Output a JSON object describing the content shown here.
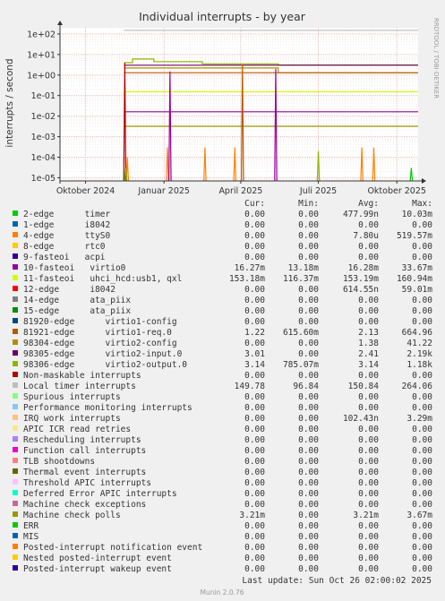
{
  "chart_data": {
    "type": "line",
    "title": "Individual interrupts - by year",
    "ylabel": "interrupts / second",
    "y_scale": "log",
    "ylim": [
      7e-06,
      200
    ],
    "y_ticks": [
      {
        "value": 100,
        "label": "1e+02"
      },
      {
        "value": 10,
        "label": "1e+01"
      },
      {
        "value": 1,
        "label": "1e+00"
      },
      {
        "value": 0.1,
        "label": "1e-01"
      },
      {
        "value": 0.01,
        "label": "1e-02"
      },
      {
        "value": 0.001,
        "label": "1e-03"
      },
      {
        "value": 0.0001,
        "label": "1e-04"
      },
      {
        "value": 1e-05,
        "label": "1e-05"
      }
    ],
    "xlim": [
      "2024-09-01",
      "2025-10-26"
    ],
    "x_ticks": [
      {
        "date": "2024-10-01",
        "label": "Oktober 2024"
      },
      {
        "date": "2025-01-01",
        "label": "Januar 2025"
      },
      {
        "date": "2025-04-01",
        "label": "April 2025"
      },
      {
        "date": "2025-07-01",
        "label": "Juli 2025"
      },
      {
        "date": "2025-10-01",
        "label": "Oktober 2025"
      }
    ],
    "grid": true,
    "side_label": "RRDTOOL / TOBI OETIKER",
    "columns": [
      "Cur:",
      "Min:",
      "Avg:",
      "Max:"
    ],
    "series": [
      {
        "name": "2-edge      timer",
        "color": "#00cc00",
        "cur": "0.00",
        "min": "0.00",
        "avg": "477.99n",
        "max": "10.03m"
      },
      {
        "name": "1-edge      i8042",
        "color": "#0066b3",
        "cur": "0.00",
        "min": "0.00",
        "avg": "0.00",
        "max": "0.00"
      },
      {
        "name": "4-edge      ttyS0",
        "color": "#ff8000",
        "cur": "0.00",
        "min": "0.00",
        "avg": "7.80u",
        "max": "519.57m"
      },
      {
        "name": "8-edge      rtc0",
        "color": "#ffcc00",
        "cur": "0.00",
        "min": "0.00",
        "avg": "0.00",
        "max": "0.00"
      },
      {
        "name": "9-fasteoi   acpi",
        "color": "#330099",
        "cur": "0.00",
        "min": "0.00",
        "avg": "0.00",
        "max": "0.00"
      },
      {
        "name": "10-fasteoi   virtio0",
        "color": "#990099",
        "cur": "16.27m",
        "min": "13.18m",
        "avg": "16.28m",
        "max": "33.67m"
      },
      {
        "name": "11-fasteoi   uhci_hcd:usb1, qxl",
        "color": "#ccff00",
        "cur": "153.18m",
        "min": "116.37m",
        "avg": "153.19m",
        "max": "160.94m"
      },
      {
        "name": "12-edge      i8042",
        "color": "#ff0000",
        "cur": "0.00",
        "min": "0.00",
        "avg": "614.55n",
        "max": "59.01m"
      },
      {
        "name": "14-edge      ata_piix",
        "color": "#808080",
        "cur": "0.00",
        "min": "0.00",
        "avg": "0.00",
        "max": "0.00"
      },
      {
        "name": "15-edge      ata_piix",
        "color": "#008f00",
        "cur": "0.00",
        "min": "0.00",
        "avg": "0.00",
        "max": "0.00"
      },
      {
        "name": "81920-edge      virtio1-config",
        "color": "#00487d",
        "cur": "0.00",
        "min": "0.00",
        "avg": "0.00",
        "max": "0.00"
      },
      {
        "name": "81921-edge      virtio1-req.0",
        "color": "#b35a00",
        "cur": "1.22",
        "min": "615.60m",
        "avg": "2.13",
        "max": "664.96"
      },
      {
        "name": "98304-edge      virtio2-config",
        "color": "#b38f00",
        "cur": "0.00",
        "min": "0.00",
        "avg": "1.38",
        "max": "41.22"
      },
      {
        "name": "98305-edge      virtio2-input.0",
        "color": "#6b006b",
        "cur": "3.01",
        "min": "0.00",
        "avg": "2.41",
        "max": "2.19k"
      },
      {
        "name": "98306-edge      virtio2-output.0",
        "color": "#8fb300",
        "cur": "3.14",
        "min": "785.07m",
        "avg": "3.14",
        "max": "1.18k"
      },
      {
        "name": "Non-maskable interrupts",
        "color": "#b30000",
        "cur": "0.00",
        "min": "0.00",
        "avg": "0.00",
        "max": "0.00"
      },
      {
        "name": "Local timer interrupts",
        "color": "#bebebe",
        "cur": "149.78",
        "min": "96.84",
        "avg": "150.84",
        "max": "264.06"
      },
      {
        "name": "Spurious interrupts",
        "color": "#80ff80",
        "cur": "0.00",
        "min": "0.00",
        "avg": "0.00",
        "max": "0.00"
      },
      {
        "name": "Performance monitoring interrupts",
        "color": "#80c9ff",
        "cur": "0.00",
        "min": "0.00",
        "avg": "0.00",
        "max": "0.00"
      },
      {
        "name": "IRQ work interrupts",
        "color": "#ffc080",
        "cur": "0.00",
        "min": "0.00",
        "avg": "102.43n",
        "max": "3.29m"
      },
      {
        "name": "APIC ICR read retries",
        "color": "#ffe680",
        "cur": "0.00",
        "min": "0.00",
        "avg": "0.00",
        "max": "0.00"
      },
      {
        "name": "Rescheduling interrupts",
        "color": "#aa80ff",
        "cur": "0.00",
        "min": "0.00",
        "avg": "0.00",
        "max": "0.00"
      },
      {
        "name": "Function call interrupts",
        "color": "#ee00cc",
        "cur": "0.00",
        "min": "0.00",
        "avg": "0.00",
        "max": "0.00"
      },
      {
        "name": "TLB shootdowns",
        "color": "#ff8080",
        "cur": "0.00",
        "min": "0.00",
        "avg": "0.00",
        "max": "0.00"
      },
      {
        "name": "Thermal event interrupts",
        "color": "#666600",
        "cur": "0.00",
        "min": "0.00",
        "avg": "0.00",
        "max": "0.00"
      },
      {
        "name": "Threshold APIC interrupts",
        "color": "#ffbfff",
        "cur": "0.00",
        "min": "0.00",
        "avg": "0.00",
        "max": "0.00"
      },
      {
        "name": "Deferred Error APIC interrupts",
        "color": "#00ffcc",
        "cur": "0.00",
        "min": "0.00",
        "avg": "0.00",
        "max": "0.00"
      },
      {
        "name": "Machine check exceptions",
        "color": "#cc6699",
        "cur": "0.00",
        "min": "0.00",
        "avg": "0.00",
        "max": "0.00"
      },
      {
        "name": "Machine check polls",
        "color": "#999900",
        "cur": "3.21m",
        "min": "0.00",
        "avg": "3.21m",
        "max": "3.67m"
      },
      {
        "name": "ERR",
        "color": "#00cc00",
        "cur": "0.00",
        "min": "0.00",
        "avg": "0.00",
        "max": "0.00"
      },
      {
        "name": "MIS",
        "color": "#0066b3",
        "cur": "0.00",
        "min": "0.00",
        "avg": "0.00",
        "max": "0.00"
      },
      {
        "name": "Posted-interrupt notification event",
        "color": "#ff8000",
        "cur": "0.00",
        "min": "0.00",
        "avg": "0.00",
        "max": "0.00"
      },
      {
        "name": "Nested posted-interrupt event",
        "color": "#ffcc00",
        "cur": "0.00",
        "min": "0.00",
        "avg": "0.00",
        "max": "0.00"
      },
      {
        "name": "Posted-interrupt wakeup event",
        "color": "#330099",
        "cur": "0.00",
        "min": "0.00",
        "avg": "0.00",
        "max": "0.00"
      }
    ],
    "lines": [
      {
        "color": "#bebebe",
        "segments": [
          {
            "from": "2024-11-15",
            "to": "2025-10-26",
            "value": 150
          }
        ]
      },
      {
        "color": "#8fb300",
        "segments": [
          {
            "from": "2024-11-15",
            "to": "2024-11-25",
            "value": 4
          },
          {
            "from": "2024-11-25",
            "to": "2024-12-20",
            "value": 6
          },
          {
            "from": "2024-12-20",
            "to": "2025-02-15",
            "value": 4.5
          },
          {
            "from": "2025-02-15",
            "to": "2025-05-15",
            "value": 3.5
          },
          {
            "from": "2025-05-15",
            "to": "2025-10-26",
            "value": 3.1
          }
        ]
      },
      {
        "color": "#6b006b",
        "segments": [
          {
            "from": "2024-11-15",
            "to": "2025-10-26",
            "value": 3
          }
        ]
      },
      {
        "color": "#b38f00",
        "segments": [
          {
            "from": "2024-11-15",
            "to": "2025-05-15",
            "value": 2.2
          },
          {
            "from": "2025-05-15",
            "to": "2025-10-26",
            "value": 1.3
          }
        ]
      },
      {
        "color": "#b35a00",
        "segments": [
          {
            "from": "2024-11-15",
            "to": "2025-10-26",
            "value": 1.3
          }
        ]
      },
      {
        "color": "#ccff00",
        "segments": [
          {
            "from": "2024-11-15",
            "to": "2025-10-26",
            "value": 0.153
          }
        ]
      },
      {
        "color": "#990099",
        "segments": [
          {
            "from": "2024-11-15",
            "to": "2025-10-26",
            "value": 0.0163
          }
        ]
      },
      {
        "color": "#999900",
        "segments": [
          {
            "from": "2024-11-15",
            "to": "2025-10-26",
            "value": 0.0032
          }
        ]
      }
    ],
    "spikes": [
      {
        "date": "2024-11-16",
        "value": 4,
        "color": "#b30000"
      },
      {
        "date": "2024-11-17",
        "value": 3e-05,
        "color": "#00cc00"
      },
      {
        "date": "2024-11-19",
        "value": 0.0001,
        "color": "#ff8000"
      },
      {
        "date": "2025-01-05",
        "value": 0.0003,
        "color": "#ff8000"
      },
      {
        "date": "2025-01-08",
        "value": 1.5,
        "color": "#990099"
      },
      {
        "date": "2025-02-18",
        "value": 0.0003,
        "color": "#ff8000"
      },
      {
        "date": "2025-03-25",
        "value": 0.0003,
        "color": "#ff8000"
      },
      {
        "date": "2025-04-03",
        "value": 3,
        "color": "#b35a00"
      },
      {
        "date": "2025-05-12",
        "value": 2,
        "color": "#990099"
      },
      {
        "date": "2025-07-01",
        "value": 0.0002,
        "color": "#8fb300"
      },
      {
        "date": "2025-08-21",
        "value": 0.0003,
        "color": "#ff8000"
      },
      {
        "date": "2025-09-04",
        "value": 0.0003,
        "color": "#ff8000"
      },
      {
        "date": "2025-10-18",
        "value": 3e-05,
        "color": "#00cc00"
      }
    ],
    "last_update": "Last update: Sun Oct 26 02:00:02 2025",
    "footer": "Munin 2.0.76"
  }
}
